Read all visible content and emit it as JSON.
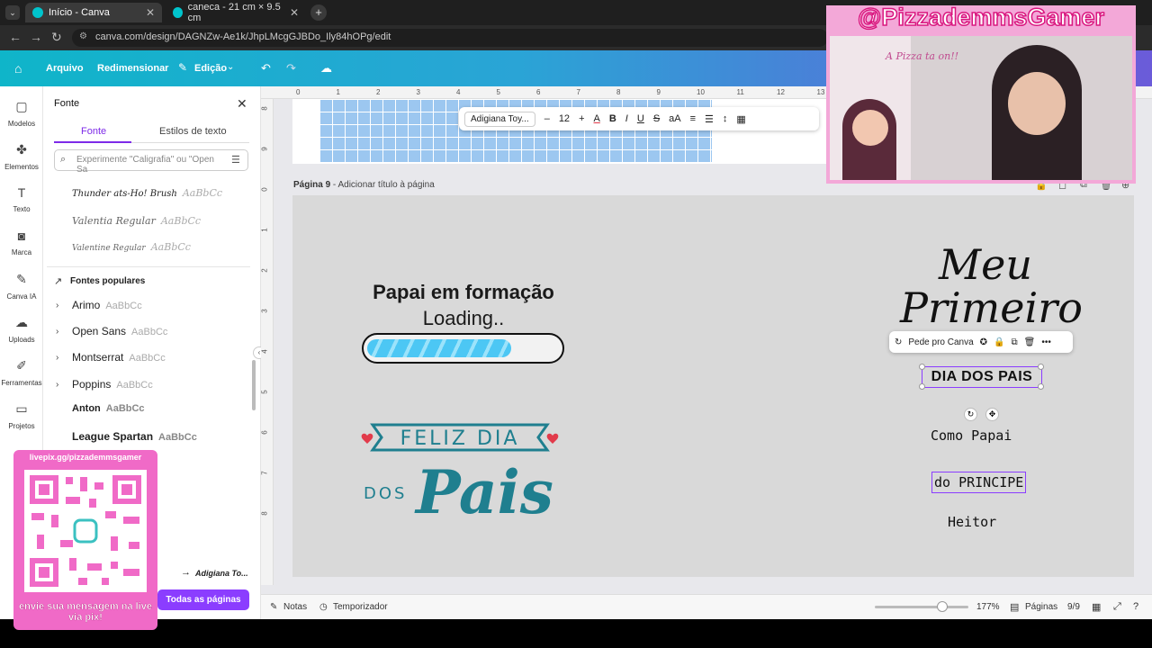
{
  "browser": {
    "tabs": [
      {
        "title": "Início - Canva"
      },
      {
        "title": "caneca - 21 cm × 9.5 cm"
      }
    ],
    "url": "canva.com/design/DAGNZw-Ae1k/JhpLMcgGJBDo_Ily84hOPg/edit"
  },
  "topbar": {
    "arquivo": "Arquivo",
    "redimensionar": "Redimensionar",
    "edicao": "Edição"
  },
  "rail": [
    {
      "label": "Modelos",
      "icon": "▢"
    },
    {
      "label": "Elementos",
      "icon": "✤"
    },
    {
      "label": "Texto",
      "icon": "T"
    },
    {
      "label": "Marca",
      "icon": "◙"
    },
    {
      "label": "Canva IA",
      "icon": "✎"
    },
    {
      "label": "Uploads",
      "icon": "☁"
    },
    {
      "label": "Ferramentas",
      "icon": "✐"
    },
    {
      "label": "Projetos",
      "icon": "▭"
    }
  ],
  "panel": {
    "title": "Fonte",
    "tab_fonte": "Fonte",
    "tab_estilos": "Estilos de texto",
    "search_placeholder": "Experimente \"Caligrafia\" ou \"Open Sa",
    "recent_fonts": [
      {
        "name": "Thunder ats-Ho! Brush",
        "sample": "AaBbCc"
      },
      {
        "name": "Valentia Regular",
        "sample": "AaBbCc"
      },
      {
        "name": "Valentine Regular",
        "sample": "AaBbCc"
      }
    ],
    "popular_heading": "Fontes populares",
    "popular_fonts": [
      {
        "name": "Arimo",
        "sample": "AaBbCc"
      },
      {
        "name": "Open Sans",
        "sample": "AaBbCc"
      },
      {
        "name": "Montserrat",
        "sample": "AaBbCc"
      },
      {
        "name": "Poppins",
        "sample": "AaBbCc"
      },
      {
        "name": "Anton",
        "sample": "AaBbCc"
      },
      {
        "name": "League Spartan",
        "sample": "AaBbCc"
      }
    ],
    "bottom_font": "Adigiana To...",
    "todas": "Todas as páginas"
  },
  "canvas": {
    "ruler_top": [
      "0",
      "1",
      "2",
      "3",
      "4",
      "5",
      "6",
      "7",
      "8",
      "9",
      "10",
      "11",
      "12",
      "13"
    ],
    "ruler_left": [
      "8",
      "9",
      "0",
      "1",
      "2",
      "3",
      "4",
      "5",
      "6",
      "7",
      "8"
    ],
    "page_label": "Página 9",
    "page_label_hint": "- Adicionar título à página",
    "papai_title": "Papai em formação",
    "loading": "Loading..",
    "progress": 0.75,
    "feliz_dia": "FELIZ DIA",
    "dos": "DOS",
    "pais_script": "Pais",
    "meu": "Meu",
    "primeiro": "Primeiro",
    "dia_dos_pais": "DIA DOS PAIS",
    "como_papai": "Como Papai",
    "do_principe": "do PRINCIPE",
    "heitor": "Heitor",
    "ctx_menu_label": "Pede pro Canva"
  },
  "text_toolbar": {
    "font": "Adigiana Toy...",
    "size": "12"
  },
  "bottombar": {
    "notas": "Notas",
    "temporizador": "Temporizador",
    "zoom": "177%",
    "paginas": "Páginas",
    "page_count": "9/9"
  },
  "overlays": {
    "cam_title": "@PizzademmsGamer",
    "cam_sign": "A Pizza ta on!!",
    "qr_url": "livepix.gg/pizzademmsgamer",
    "qr_msg": "envie sua mensagem na live via pix!"
  },
  "colors": {
    "accent": "#8b3dff",
    "teal": "#1f7f8f",
    "progress": "#4cc7f4"
  }
}
